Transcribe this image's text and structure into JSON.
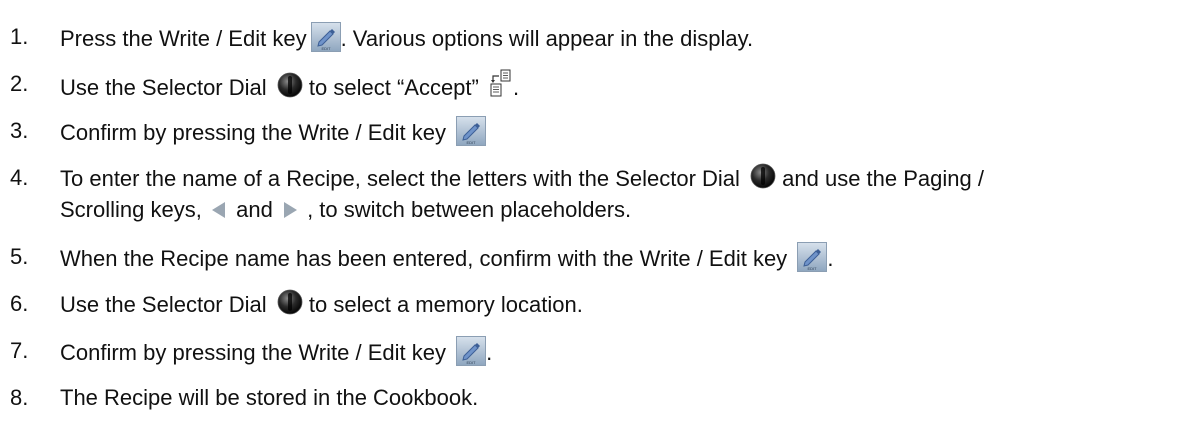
{
  "steps": [
    {
      "number": "1.",
      "parts": [
        "Press the Write / Edit key",
        ". Various options will appear in the display."
      ]
    },
    {
      "number": "2.",
      "parts": [
        "Use the Selector Dial",
        "to select “Accept”",
        "."
      ]
    },
    {
      "number": "3.",
      "parts": [
        "Confirm by pressing the Write / Edit key"
      ]
    },
    {
      "number": "4.",
      "parts": [
        "To enter the name of a Recipe, select the letters with the Selector Dial",
        "and use the Paging /",
        "Scrolling keys,",
        "and",
        ", to switch between placeholders."
      ]
    },
    {
      "number": "5.",
      "parts": [
        "When the Recipe name has been entered, confirm with the Write / Edit key",
        "."
      ]
    },
    {
      "number": "6.",
      "parts": [
        "Use the Selector Dial",
        "to select a memory location."
      ]
    },
    {
      "number": "7.",
      "parts": [
        "Confirm by pressing the Write / Edit key",
        "."
      ]
    },
    {
      "number": "8.",
      "parts": [
        "The Recipe will be stored in the Cookbook."
      ]
    }
  ],
  "icons": {
    "edit_key": "pencil-edit-key-icon",
    "selector_dial": "selector-dial-icon",
    "accept": "accept-document-icon",
    "page_left": "left-triangle-arrow-icon",
    "page_right": "right-triangle-arrow-icon",
    "edit_key_bg": "#9fb3c8",
    "edit_key_pen": "#4a6ea8",
    "dial_color": "#222222"
  }
}
